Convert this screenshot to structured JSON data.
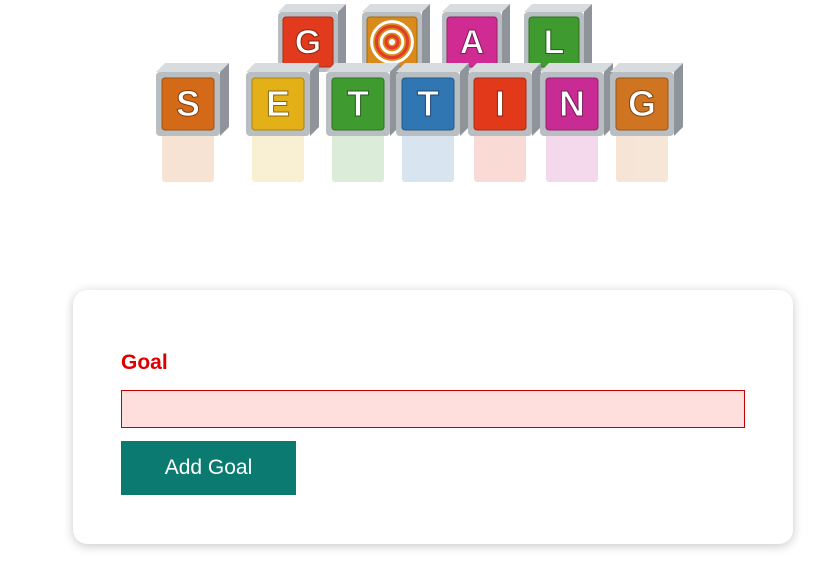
{
  "logo": {
    "top_letters": [
      "G",
      "O",
      "A",
      "L"
    ],
    "bottom_letters": [
      "S",
      "E",
      "T",
      "T",
      "I",
      "N",
      "G"
    ],
    "top_colors": [
      "#e13a1c",
      "#d98a1a",
      "#d02b93",
      "#3f9a2f"
    ],
    "bottom_colors": [
      "#d46a18",
      "#e3b017",
      "#3f9a2f",
      "#2f76b3",
      "#e1391a",
      "#c82c94",
      "#cf7421"
    ]
  },
  "form": {
    "goal_label": "Goal",
    "goal_value": "",
    "goal_placeholder": "",
    "add_button_label": "Add Goal"
  },
  "colors": {
    "label": "#e00000",
    "input_bg": "#ffdede",
    "input_border": "#c40000",
    "button_bg": "#0b7b72",
    "button_text": "#ffffff"
  }
}
